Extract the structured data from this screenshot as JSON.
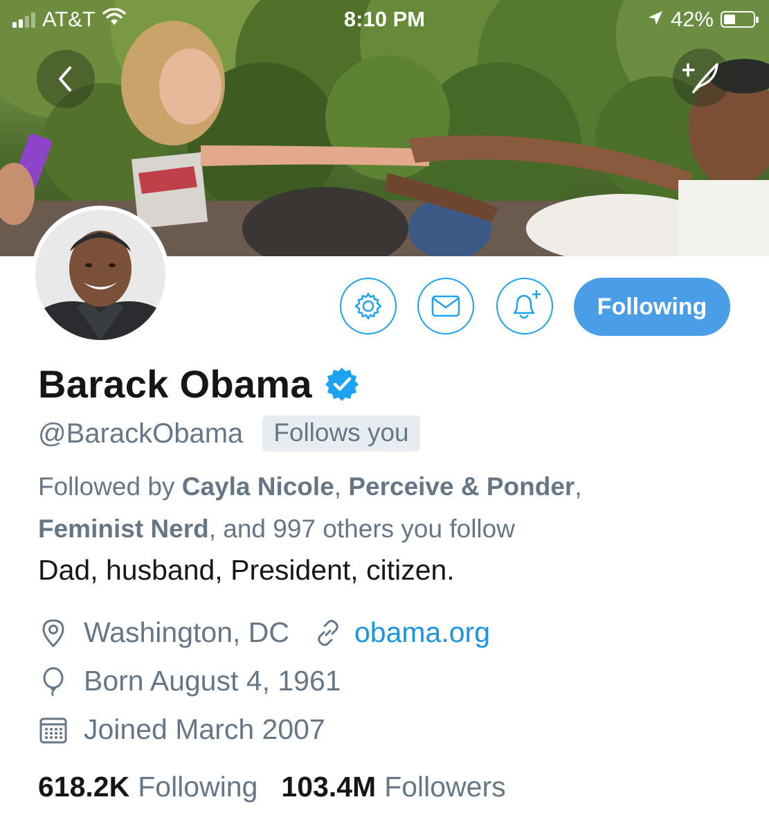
{
  "status_bar": {
    "carrier": "AT&T",
    "time": "8:10 PM",
    "battery": "42%"
  },
  "profile": {
    "name": "Barack Obama",
    "handle": "@BarackObama",
    "follows_you": "Follows you",
    "followed_by": {
      "prefix": "Followed by ",
      "names": [
        "Cayla Nicole",
        "Perceive & Ponder",
        "Feminist Nerd"
      ],
      "sep1": ", ",
      "sep2": ", ",
      "sep3": ", and ",
      "suffix": "997 others you follow"
    },
    "bio": "Dad, husband, President, citizen.",
    "location": "Washington, DC",
    "website": "obama.org",
    "born": "Born August 4, 1961",
    "joined": "Joined March 2007",
    "stats": {
      "following_count": "618.2K",
      "following_label": "Following",
      "followers_count": "103.4M",
      "followers_label": "Followers"
    }
  },
  "actions": {
    "following_button": "Following"
  },
  "icons": {
    "back": "chevron-left-icon",
    "compose": "compose-tweet-icon",
    "settings": "gear-icon",
    "message": "envelope-icon",
    "notify": "bell-plus-icon",
    "verified": "verified-badge-icon",
    "location": "location-pin-icon",
    "link": "link-icon",
    "birthday": "balloon-icon",
    "calendar": "calendar-icon"
  },
  "colors": {
    "accent": "#1da1f2",
    "button_fill": "#4a9ee8",
    "link": "#1b95e0",
    "secondary_text": "#657786",
    "primary_text": "#14171a",
    "badge_bg": "#e6ecf0"
  }
}
